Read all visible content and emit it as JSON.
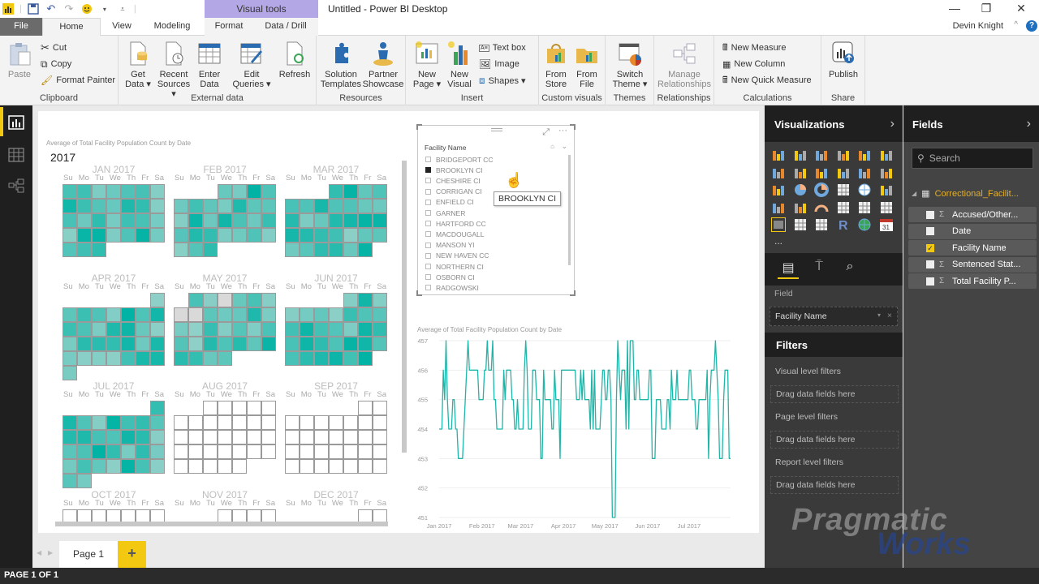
{
  "window": {
    "title": "Untitled - Power BI Desktop",
    "contextual_tab_group": "Visual tools",
    "user": "Devin Knight",
    "controls": {
      "minimize": "—",
      "restore": "❐",
      "close": "✕"
    }
  },
  "tabs": [
    "File",
    "Home",
    "View",
    "Modeling",
    "Format",
    "Data / Drill"
  ],
  "active_tab": "Home",
  "ribbon": {
    "clipboard": {
      "label": "Clipboard",
      "paste": "Paste",
      "cut": "Cut",
      "copy": "Copy",
      "format_painter": "Format Painter"
    },
    "external_data": {
      "label": "External data",
      "get_data": [
        "Get",
        "Data ▾"
      ],
      "recent_sources": [
        "Recent",
        "Sources ▾"
      ],
      "enter_data": [
        "Enter",
        "Data"
      ],
      "edit_queries": [
        "Edit",
        "Queries ▾"
      ],
      "refresh": [
        "Refresh",
        ""
      ]
    },
    "resources": {
      "label": "Resources",
      "solution_templates": [
        "Solution",
        "Templates"
      ],
      "partner_showcase": [
        "Partner",
        "Showcase"
      ]
    },
    "insert": {
      "label": "Insert",
      "new_page": [
        "New",
        "Page ▾"
      ],
      "new_visual": [
        "New",
        "Visual"
      ],
      "text_box": "Text box",
      "image": "Image",
      "shapes": "Shapes ▾"
    },
    "custom_visuals": {
      "label": "Custom visuals",
      "from_store": [
        "From",
        "Store"
      ],
      "from_file": [
        "From",
        "File"
      ]
    },
    "themes": {
      "label": "Themes",
      "switch_theme": [
        "Switch",
        "Theme ▾"
      ]
    },
    "relationships": {
      "label": "Relationships",
      "manage": [
        "Manage",
        "Relationships"
      ]
    },
    "calculations": {
      "label": "Calculations",
      "new_measure": "New Measure",
      "new_column": "New Column",
      "new_quick_measure": "New Quick Measure"
    },
    "share": {
      "label": "Share",
      "publish": "Publish"
    }
  },
  "calendar_visual": {
    "title": "Average of Total Facility Population Count by Date",
    "year": "2017",
    "dow": [
      "Su",
      "Mo",
      "Tu",
      "We",
      "Th",
      "Fr",
      "Sa"
    ],
    "months": [
      {
        "name": "JAN 2017",
        "start_dow": 0,
        "days": 31,
        "has_data": true
      },
      {
        "name": "FEB 2017",
        "start_dow": 3,
        "days": 28,
        "has_data": true
      },
      {
        "name": "MAR 2017",
        "start_dow": 3,
        "days": 31,
        "has_data": true
      },
      {
        "name": "APR 2017",
        "start_dow": 6,
        "days": 30,
        "has_data": true
      },
      {
        "name": "MAY 2017",
        "start_dow": 1,
        "days": 31,
        "has_data": true,
        "blank_days": [
          3,
          7,
          8
        ]
      },
      {
        "name": "JUN 2017",
        "start_dow": 4,
        "days": 30,
        "has_data": true
      },
      {
        "name": "JUL 2017",
        "start_dow": 6,
        "days": 31,
        "has_data": true
      },
      {
        "name": "AUG 2017",
        "start_dow": 2,
        "days": 31,
        "has_data": false
      },
      {
        "name": "SEP 2017",
        "start_dow": 5,
        "days": 30,
        "has_data": false
      },
      {
        "name": "OCT 2017",
        "start_dow": 0,
        "days": 31,
        "has_data": false
      },
      {
        "name": "NOV 2017",
        "start_dow": 3,
        "days": 30,
        "has_data": false
      },
      {
        "name": "DEC 2017",
        "start_dow": 5,
        "days": 31,
        "has_data": false
      }
    ],
    "colors": {
      "low": "#8fd0c8",
      "high": "#00b3a4",
      "blank": "#d9d9d9"
    }
  },
  "slicer": {
    "header": "Facility Name",
    "items": [
      {
        "label": "BRIDGEPORT CC",
        "checked": false
      },
      {
        "label": "BROOKLYN CI",
        "checked": true
      },
      {
        "label": "CHESHIRE CI",
        "checked": false
      },
      {
        "label": "CORRIGAN CI",
        "checked": false
      },
      {
        "label": "ENFIELD CI",
        "checked": false
      },
      {
        "label": "GARNER",
        "checked": false
      },
      {
        "label": "HARTFORD CC",
        "checked": false
      },
      {
        "label": "MACDOUGALL",
        "checked": false
      },
      {
        "label": "MANSON YI",
        "checked": false
      },
      {
        "label": "NEW HAVEN CC",
        "checked": false
      },
      {
        "label": "NORTHERN CI",
        "checked": false
      },
      {
        "label": "OSBORN CI",
        "checked": false
      },
      {
        "label": "RADGOWSKI",
        "checked": false
      }
    ],
    "tooltip": "BROOKLYN CI"
  },
  "chart_data": {
    "type": "line",
    "title": "Average of Total Facility Population Count by Date",
    "xlabel": "",
    "ylabel": "",
    "x_ticks": [
      "Jan 2017",
      "Feb 2017",
      "Mar 2017",
      "Apr 2017",
      "May 2017",
      "Jun 2017",
      "Jul 2017"
    ],
    "y_ticks": [
      451,
      452,
      453,
      454,
      455,
      456,
      457
    ],
    "ylim": [
      451,
      457
    ],
    "grid": true,
    "color": "#1fb5a8",
    "x_start": "2017-01-01",
    "x_end": "2017-07-31",
    "series": [
      {
        "name": "Average of Total Facility Population Count",
        "values": [
          454,
          454,
          454,
          456,
          455,
          457,
          455,
          454,
          454,
          454,
          455,
          455,
          454,
          454,
          453,
          453,
          453,
          453,
          454,
          455,
          456,
          457,
          456,
          456,
          456,
          456,
          456,
          456,
          456,
          455,
          455,
          455,
          455,
          456,
          456,
          457,
          456,
          456,
          456,
          457,
          455,
          455,
          454,
          454,
          454,
          454,
          454,
          456,
          455,
          456,
          456,
          456,
          456,
          455,
          455,
          454,
          454,
          455,
          454,
          454,
          454,
          454,
          456,
          457,
          456,
          454,
          454,
          454,
          456,
          456,
          456,
          455,
          455,
          455,
          453,
          453,
          456,
          455,
          455,
          455,
          455,
          455,
          454,
          454,
          456,
          455,
          455,
          455,
          453,
          456,
          456,
          456,
          456,
          456,
          456,
          456,
          456,
          456,
          456,
          456,
          455,
          455,
          455,
          456,
          455,
          456,
          455,
          455,
          455,
          455,
          454,
          456,
          454,
          456,
          454,
          454,
          454,
          454,
          455,
          456,
          456,
          455,
          455,
          456,
          456,
          455,
          451,
          451,
          451,
          455,
          457,
          456,
          455,
          456,
          456,
          456,
          454,
          457,
          454,
          457,
          457,
          457,
          455,
          455,
          456,
          456,
          455,
          455,
          455,
          455,
          455,
          455,
          455,
          456,
          456,
          453,
          453,
          453,
          455,
          455,
          455,
          455,
          454,
          454,
          454,
          454,
          455,
          455,
          454,
          456,
          455,
          455,
          455,
          456,
          455,
          455,
          455,
          455,
          455,
          455,
          455,
          455,
          456,
          456,
          455,
          455,
          455,
          454,
          454,
          455,
          455,
          455,
          455,
          455,
          455,
          456,
          453,
          455,
          456,
          456,
          456,
          457,
          456,
          455,
          453,
          453,
          453,
          455,
          456,
          456,
          456,
          453,
          453
        ]
      }
    ]
  },
  "visualizations_pane": {
    "title": "Visualizations",
    "field_label": "Field",
    "field_value": "Facility Name",
    "icons": [
      "stacked-bar",
      "stacked-column",
      "clustered-bar",
      "clustered-column",
      "100-stacked-bar",
      "100-stacked-column",
      "line",
      "area",
      "stacked-area",
      "line-clustered-column",
      "line-stacked-column",
      "ribbon",
      "scatter",
      "pie",
      "donut",
      "treemap",
      "map",
      "filled-map",
      "shape-map",
      "funnel",
      "gauge",
      "card",
      "multi-row-card",
      "kpi",
      "slicer",
      "table",
      "matrix",
      "r-visual",
      "arcgis",
      "calendar"
    ],
    "more": "..."
  },
  "filters": {
    "title": "Filters",
    "sections": [
      {
        "label": "Visual level filters",
        "drop": "Drag data fields here"
      },
      {
        "label": "Page level filters",
        "drop": "Drag data fields here"
      },
      {
        "label": "Report level filters",
        "drop": "Drag data fields here"
      }
    ]
  },
  "fields_pane": {
    "title": "Fields",
    "search_placeholder": "Search",
    "table": "Correctional_Facilit...",
    "fields": [
      {
        "name": "Accused/Other...",
        "sigma": true,
        "checked": false
      },
      {
        "name": "Date",
        "sigma": false,
        "checked": false
      },
      {
        "name": "Facility Name",
        "sigma": false,
        "checked": true
      },
      {
        "name": "Sentenced Stat...",
        "sigma": true,
        "checked": false
      },
      {
        "name": "Total Facility P...",
        "sigma": true,
        "checked": false
      }
    ]
  },
  "watermark": {
    "line1": "Pragmatic",
    "line2": "Works"
  },
  "pages": {
    "tabs": [
      "Page 1"
    ],
    "add": "+"
  },
  "status": "PAGE 1 OF 1"
}
